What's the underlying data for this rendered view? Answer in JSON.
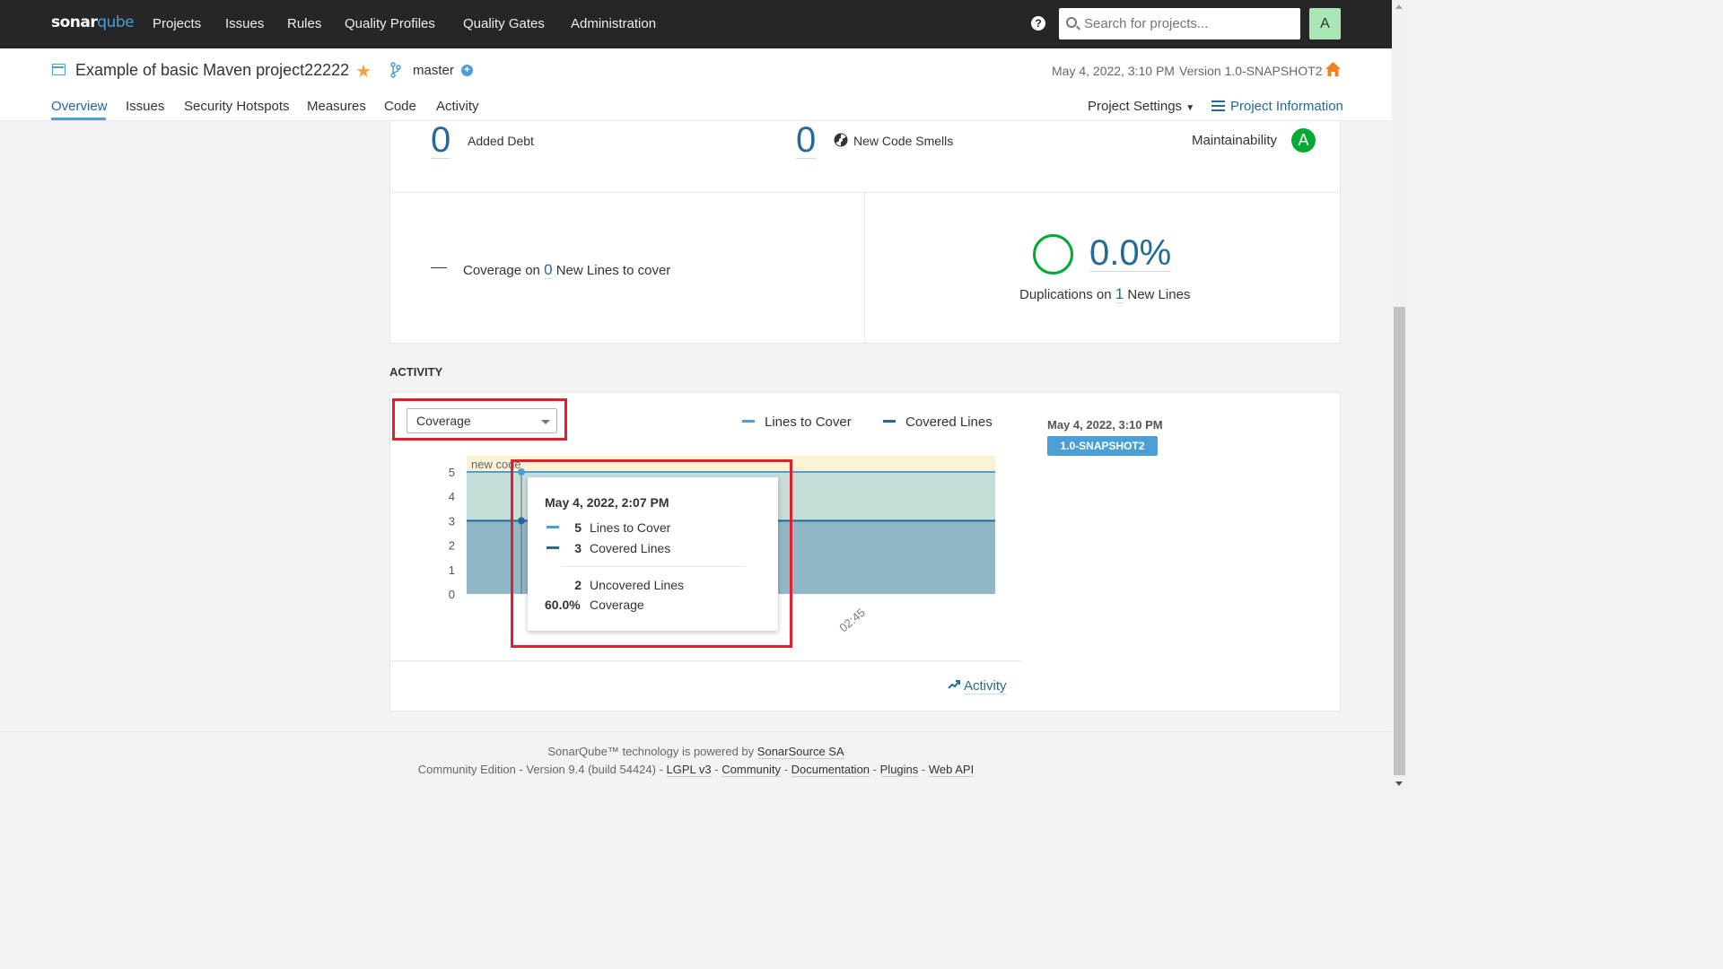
{
  "nav": {
    "logo_sonar": "sonar",
    "logo_qube": "qube",
    "items": [
      "Projects",
      "Issues",
      "Rules",
      "Quality Profiles",
      "Quality Gates",
      "Administration"
    ],
    "help": "?",
    "search_placeholder": "Search for projects...",
    "avatar_letter": "A"
  },
  "project": {
    "name": "Example of basic Maven project22222",
    "branch": "master",
    "date": "May 4, 2022, 3:10 PM",
    "version": "Version 1.0-SNAPSHOT2",
    "tabs": [
      "Overview",
      "Issues",
      "Security Hotspots",
      "Measures",
      "Code",
      "Activity"
    ],
    "settings_label": "Project Settings",
    "info_label": "Project Information"
  },
  "measures": {
    "added_debt_value": "0",
    "added_debt_label": "Added Debt",
    "new_code_smells_value": "0",
    "new_code_smells_label": "New Code Smells",
    "maintainability_label": "Maintainability",
    "maintainability_rating": "A",
    "coverage_prefix": "Coverage on",
    "coverage_new_lines": "0",
    "coverage_suffix": "New Lines to cover",
    "duplications_value": "0.0%",
    "duplications_prefix": "Duplications on",
    "duplications_new_lines": "1",
    "duplications_suffix": "New Lines"
  },
  "activity": {
    "title": "ACTIVITY",
    "graph_select": "Coverage",
    "legend": [
      {
        "label": "Lines to Cover",
        "color": "#4b9fd5"
      },
      {
        "label": "Covered Lines",
        "color": "#236a97"
      }
    ],
    "new_code_label": "new code",
    "x_tick": "02:45",
    "tooltip": {
      "date": "May 4, 2022, 2:07 PM",
      "rows": [
        {
          "value": "5",
          "label": "Lines to Cover"
        },
        {
          "value": "3",
          "label": "Covered Lines"
        }
      ],
      "uncovered_value": "2",
      "uncovered_label": "Uncovered Lines",
      "coverage_value": "60.0%",
      "coverage_label": "Coverage"
    },
    "link_label": "Activity",
    "side_date": "May 4, 2022, 3:10 PM",
    "side_version": "1.0-SNAPSHOT2"
  },
  "chart_data": {
    "type": "area",
    "yticks": [
      0,
      1,
      2,
      3,
      4,
      5
    ],
    "ylim": [
      0,
      5
    ],
    "series": [
      {
        "name": "Lines to Cover",
        "values": [
          5,
          5
        ],
        "color": "#4b9fd5"
      },
      {
        "name": "Covered Lines",
        "values": [
          3,
          3
        ],
        "color": "#236a97"
      }
    ]
  },
  "footer": {
    "line1_prefix": "SonarQube™ technology is powered by",
    "line1_link": "SonarSource SA",
    "line2_prefix": "Community Edition - Version 9.4 (build 54424) -",
    "links": [
      "LGPL v3",
      "Community",
      "Documentation",
      "Plugins",
      "Web API"
    ],
    "sep": "-"
  }
}
